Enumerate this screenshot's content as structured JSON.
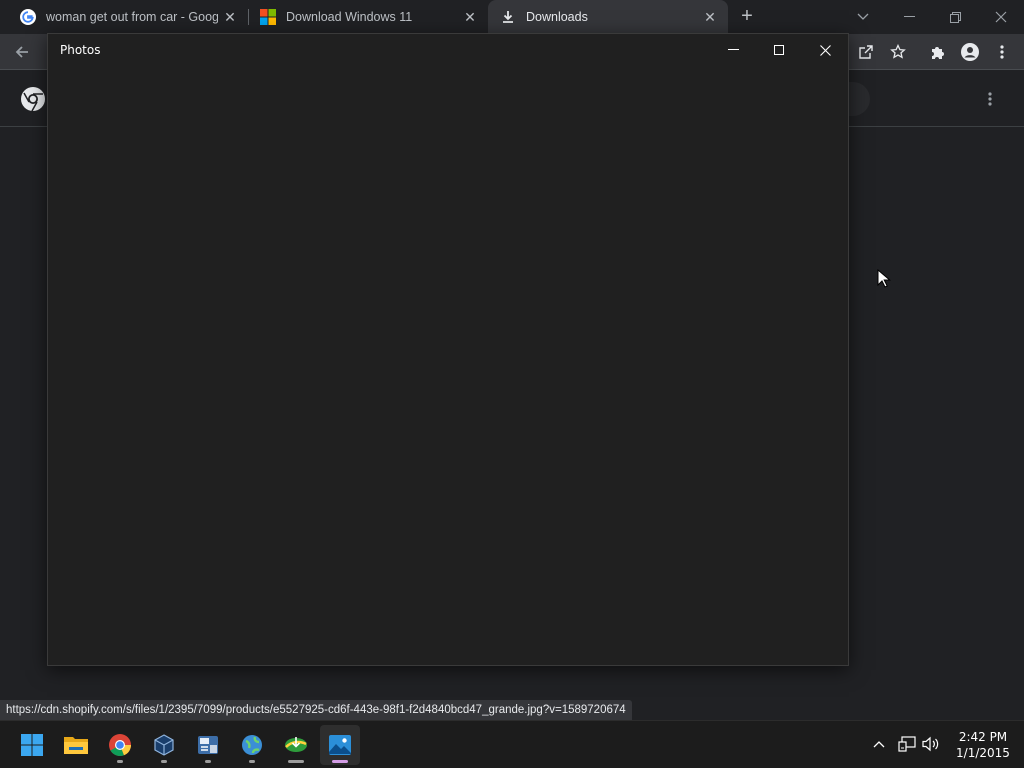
{
  "browser": {
    "tabs": [
      {
        "title": "woman get out from car - Google",
        "icon": "google-g-icon",
        "active": false
      },
      {
        "title": "Download Windows 11",
        "icon": "microsoft-logo-icon",
        "active": false
      },
      {
        "title": "Downloads",
        "icon": "download-icon",
        "active": true
      }
    ],
    "close_glyph": "✕",
    "new_tab_glyph": "+"
  },
  "photos_window": {
    "title": "Photos"
  },
  "status_url": "https://cdn.shopify.com/s/files/1/2395/7099/products/e5527925-cd6f-443e-98f1-f2d4840bcd47_grande.jpg?v=1589720674",
  "taskbar": {
    "apps": [
      "windows-start-icon",
      "file-explorer-icon",
      "chrome-icon",
      "virtualbox-icon",
      "calculator-app-icon",
      "network-globe-icon",
      "internet-download-manager-icon",
      "photos-icon"
    ],
    "clock_time": "2:42 PM",
    "clock_date": "1/1/2015"
  },
  "colors": {
    "accent": "#d49ee6",
    "tab_bg_active": "#35363a",
    "window_bg": "#202020"
  }
}
